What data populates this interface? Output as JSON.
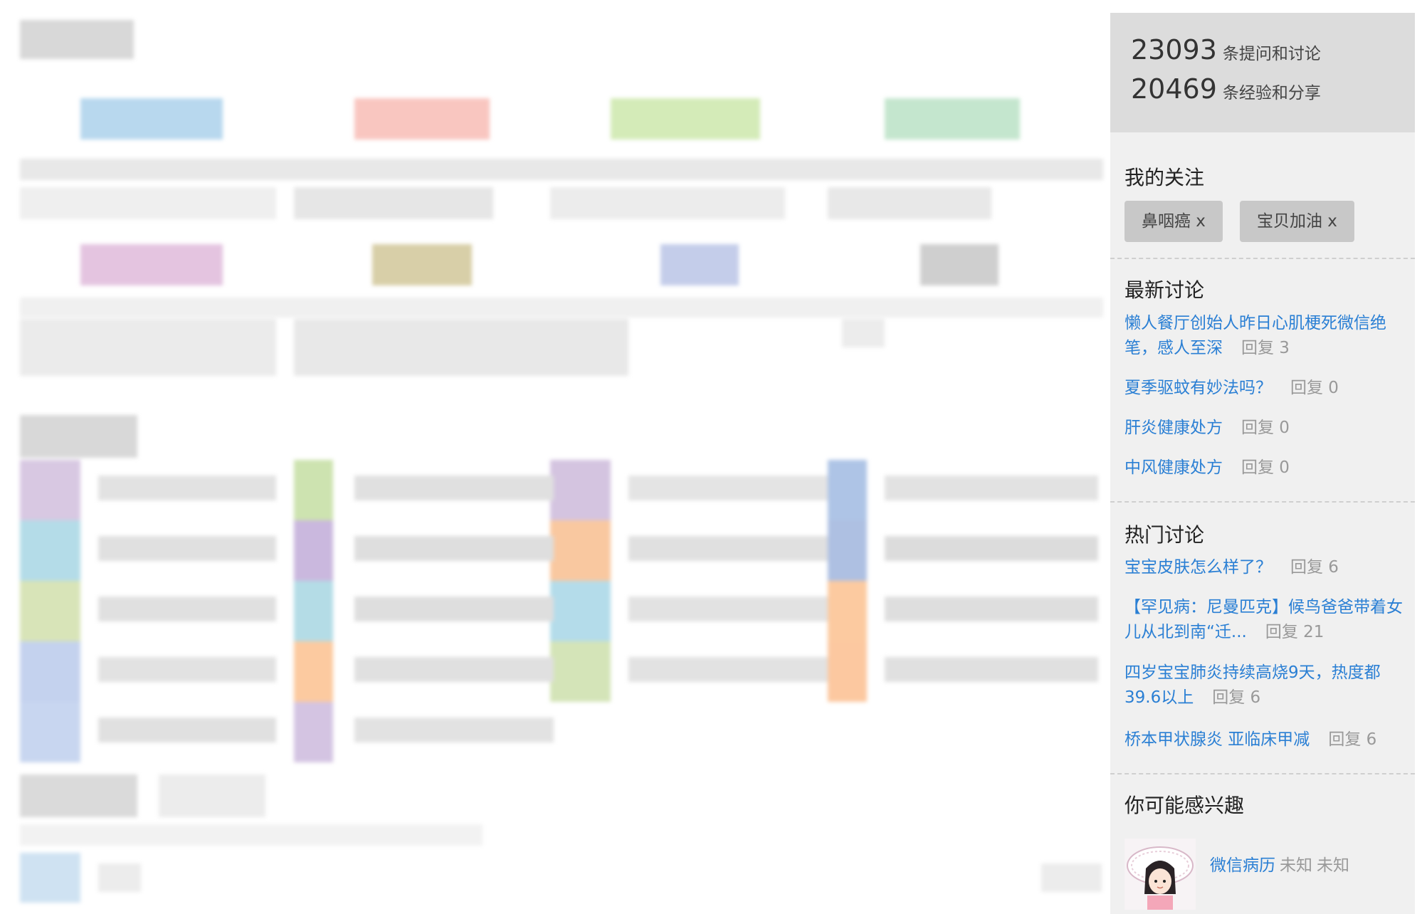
{
  "stats": {
    "questions_count": "23093",
    "questions_label": "条提问和讨论",
    "experiences_count": "20469",
    "experiences_label": "条经验和分享"
  },
  "follow": {
    "title": "我的关注",
    "tags": [
      {
        "label": "鼻咽癌 x"
      },
      {
        "label": "宝贝加油 x"
      }
    ]
  },
  "latest": {
    "title": "最新讨论",
    "items": [
      {
        "title": "懒人餐厅创始人昨日心肌梗死微信绝笔，感人至深",
        "reply": "回复 3"
      },
      {
        "title": "夏季驱蚊有妙法吗？",
        "reply": "回复 0"
      },
      {
        "title": "肝炎健康处方",
        "reply": "回复 0"
      },
      {
        "title": "中风健康处方",
        "reply": "回复 0"
      }
    ]
  },
  "hot": {
    "title": "热门讨论",
    "items": [
      {
        "title": "宝宝皮肤怎么样了？",
        "reply": "回复 6"
      },
      {
        "title": "【罕见病：尼曼匹克】候鸟爸爸带着女儿从北到南“迁...",
        "reply": "回复 21"
      },
      {
        "title": "四岁宝宝肺炎持续高烧9天，热度都39.6以上",
        "reply": "回复 6"
      },
      {
        "title": "桥本甲状腺炎 亚临床甲减",
        "reply": "回复 6"
      }
    ]
  },
  "interest": {
    "title": "你可能感兴趣",
    "items": [
      {
        "name": "微信病历",
        "meta1": "未知",
        "meta2": "未知"
      }
    ]
  },
  "colors": {
    "link": "#2a7fd4",
    "sidebar_bg": "#f0f0f0",
    "stats_bg": "#dcdcdc",
    "tag_bg": "#c8c8c8"
  }
}
